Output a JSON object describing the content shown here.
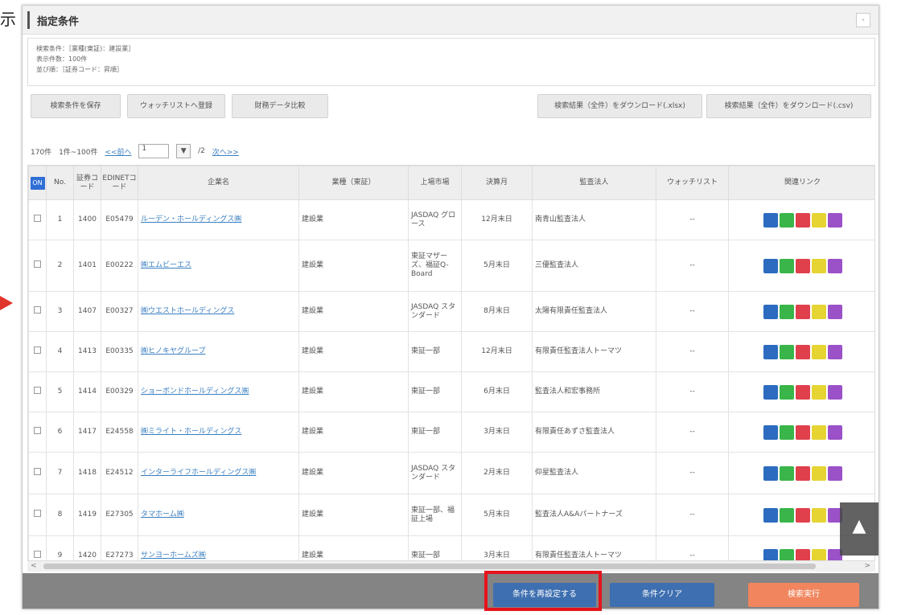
{
  "edge_char": "示",
  "panel": {
    "title": "指定条件",
    "collapse_label": "-",
    "criteria_lines": [
      "検索条件：［業種(東証)：建設業］",
      "表示件数：100件",
      "並び順：［証券コード：昇順］"
    ]
  },
  "toolbar": {
    "save_conditions": "検索条件を保存",
    "add_watchlist": "ウォッチリストへ登録",
    "compare_financials": "財務データ比較",
    "download_xlsx": "検索結果（全件）をダウンロード(.xlsx)",
    "download_csv": "検索結果（全件）をダウンロード(.csv)"
  },
  "pager": {
    "total": "170件",
    "range": "1件~100件",
    "prev_label": "<<前へ",
    "page_value": "1",
    "select_arrow": "▼",
    "page_count": "/2",
    "next_label": "次へ>>"
  },
  "table": {
    "headers": {
      "on": "ON",
      "no": "No.",
      "code": "証券コード",
      "edinet": "EDINETコード",
      "company": "企業名",
      "industry": "業種（東証）",
      "market": "上場市場",
      "fiscal": "決算月",
      "auditor": "監査法人",
      "watchlist": "ウォッチリスト",
      "links": "関連リンク"
    },
    "rows": [
      {
        "no": "1",
        "code": "1400",
        "edinet": "E05479",
        "company": "ルーデン・ホールディングス㈱",
        "industry": "建設業",
        "market": "JASDAQ グロース",
        "fiscal": "12月末日",
        "auditor": "南青山監査法人",
        "watchlist": "--"
      },
      {
        "no": "2",
        "code": "1401",
        "edinet": "E00222",
        "company": "㈱エムビーエス",
        "industry": "建設業",
        "market": "東証マザーズ、福証Q-Board",
        "fiscal": "5月末日",
        "auditor": "三優監査法人",
        "watchlist": "--"
      },
      {
        "no": "3",
        "code": "1407",
        "edinet": "E00327",
        "company": "㈱ウエストホールディングス",
        "industry": "建設業",
        "market": "JASDAQ スタンダード",
        "fiscal": "8月末日",
        "auditor": "太陽有限責任監査法人",
        "watchlist": "--"
      },
      {
        "no": "4",
        "code": "1413",
        "edinet": "E00335",
        "company": "㈱ヒノキヤグループ",
        "industry": "建設業",
        "market": "東証一部",
        "fiscal": "12月末日",
        "auditor": "有限責任監査法人トーマツ",
        "watchlist": "--"
      },
      {
        "no": "5",
        "code": "1414",
        "edinet": "E00329",
        "company": "ショーボンドホールディングス㈱",
        "industry": "建設業",
        "market": "東証一部",
        "fiscal": "6月末日",
        "auditor": "監査法人和宏事務所",
        "watchlist": "--"
      },
      {
        "no": "6",
        "code": "1417",
        "edinet": "E24558",
        "company": "㈱ミライト・ホールディングス",
        "industry": "建設業",
        "market": "東証一部",
        "fiscal": "3月末日",
        "auditor": "有限責任あずさ監査法人",
        "watchlist": "--"
      },
      {
        "no": "7",
        "code": "1418",
        "edinet": "E24512",
        "company": "インターライフホールディングス㈱",
        "industry": "建設業",
        "market": "JASDAQ スタンダード",
        "fiscal": "2月末日",
        "auditor": "仰星監査法人",
        "watchlist": "--"
      },
      {
        "no": "8",
        "code": "1419",
        "edinet": "E27305",
        "company": "タマホーム㈱",
        "industry": "建設業",
        "market": "東証一部、福証上場",
        "fiscal": "5月末日",
        "auditor": "監査法人A&Aパートナーズ",
        "watchlist": "--"
      },
      {
        "no": "9",
        "code": "1420",
        "edinet": "E27273",
        "company": "サンヨーホームズ㈱",
        "industry": "建設業",
        "market": "東証一部",
        "fiscal": "3月末日",
        "auditor": "有限責任監査法人トーマツ",
        "watchlist": "--"
      }
    ],
    "link_icons": [
      {
        "name": "company-info-icon",
        "color": "#2c6bbf"
      },
      {
        "name": "financial-data-icon",
        "color": "#39b54a"
      },
      {
        "name": "report-icon",
        "color": "#e0404c"
      },
      {
        "name": "note-icon",
        "color": "#e6d433"
      },
      {
        "name": "profile-icon",
        "color": "#9b51c7"
      }
    ]
  },
  "scroll": {
    "left_arrow": "<",
    "right_arrow": ">",
    "top_button": "▲"
  },
  "footer": {
    "reset_label": "条件を再設定する",
    "clear_label": "条件クリア",
    "search_label": "検索実行"
  },
  "annotation": {
    "highlight_color": "#e5141c"
  }
}
